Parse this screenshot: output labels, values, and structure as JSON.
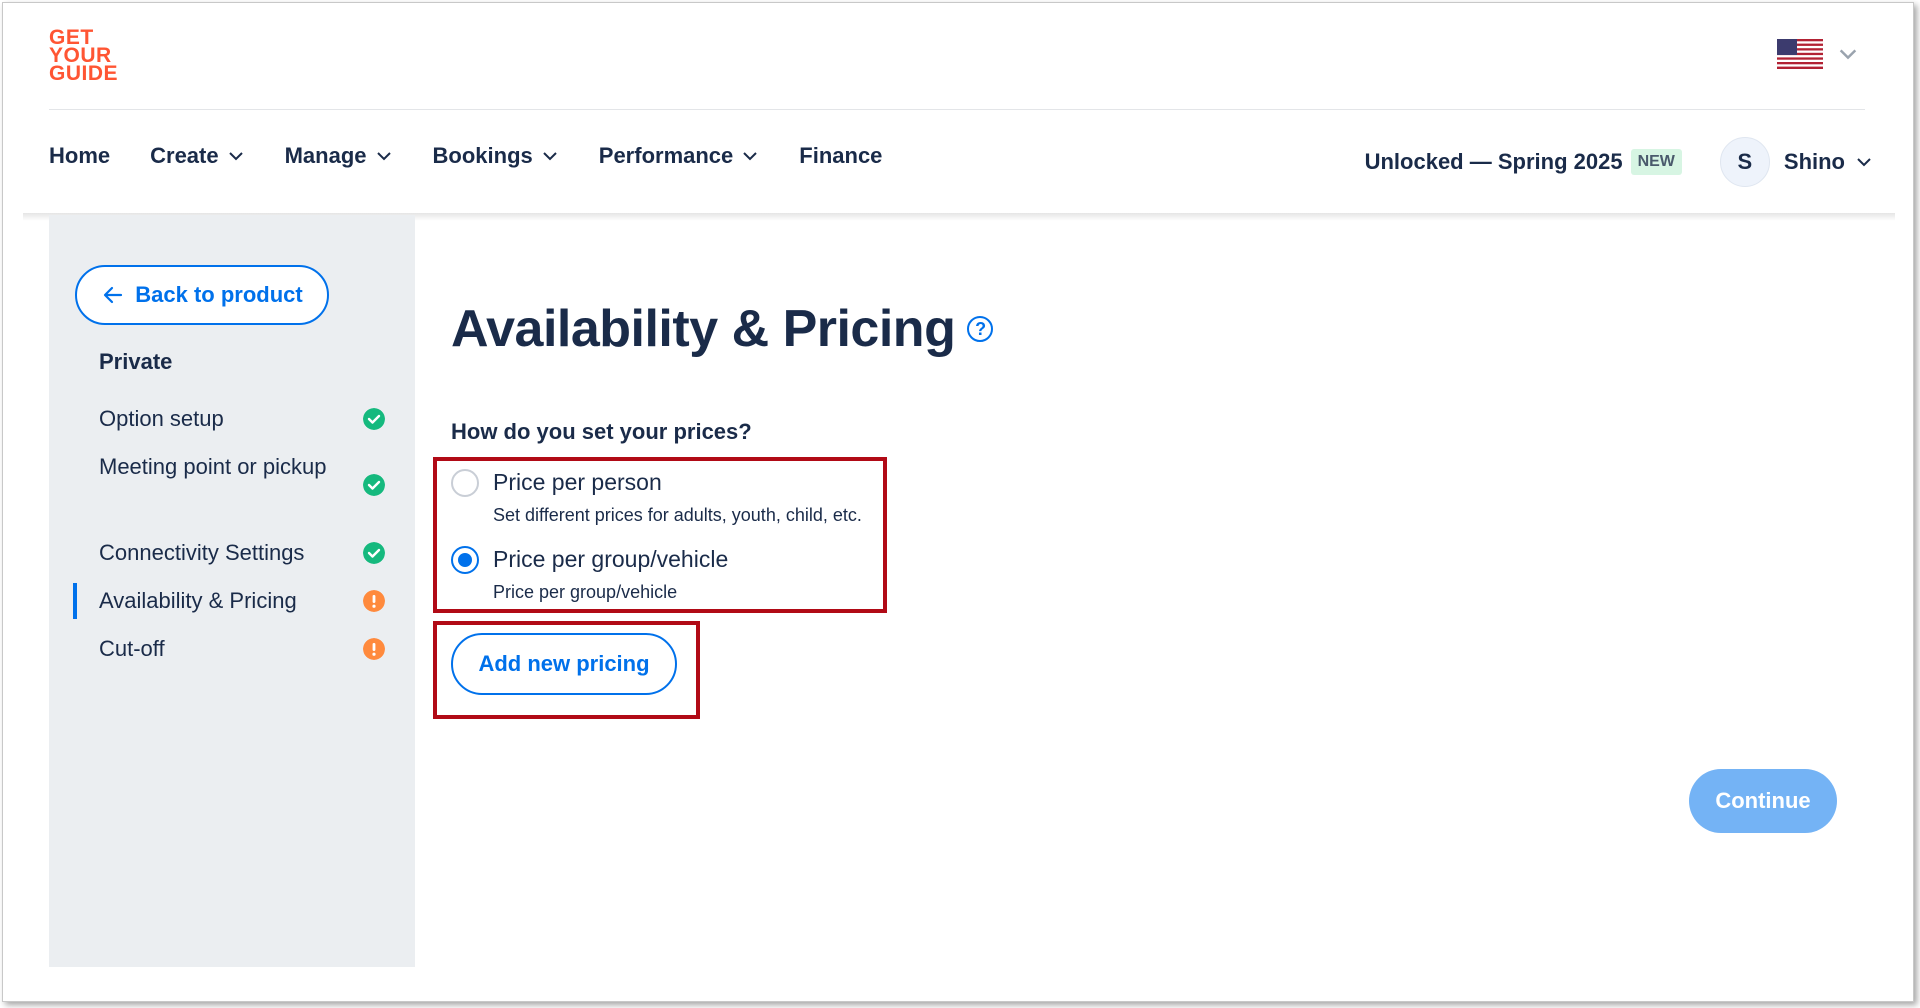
{
  "brand": {
    "logo_line1": "GET",
    "logo_line2": "YOUR",
    "logo_line3": "GUIDE",
    "accent": "#ff5533",
    "primary": "#0071eb"
  },
  "header": {
    "language_flag": "us-flag-icon",
    "nav": [
      {
        "label": "Home",
        "has_menu": false
      },
      {
        "label": "Create",
        "has_menu": true
      },
      {
        "label": "Manage",
        "has_menu": true
      },
      {
        "label": "Bookings",
        "has_menu": true
      },
      {
        "label": "Performance",
        "has_menu": true
      },
      {
        "label": "Finance",
        "has_menu": false
      }
    ],
    "promo": "Unlocked — Spring 2025",
    "promo_badge": "NEW",
    "user_initial": "S",
    "user_name": "Shino"
  },
  "sidebar": {
    "back_label": "Back to product",
    "title": "Private",
    "items": [
      {
        "label": "Option setup",
        "status": "complete"
      },
      {
        "label": "Meeting point or pickup",
        "status": "complete"
      },
      {
        "label": "Connectivity Settings",
        "status": "complete"
      },
      {
        "label": "Availability & Pricing",
        "status": "incomplete",
        "active": true
      },
      {
        "label": "Cut-off",
        "status": "incomplete"
      }
    ]
  },
  "main": {
    "title": "Availability & Pricing",
    "help_glyph": "?",
    "question": "How do you set your prices?",
    "options": [
      {
        "label": "Price per person",
        "description": "Set different prices for adults, youth, child, etc.",
        "selected": false
      },
      {
        "label": "Price per group/vehicle",
        "description": "Price per group/vehicle",
        "selected": true
      }
    ],
    "add_pricing_label": "Add new pricing",
    "continue_label": "Continue"
  }
}
